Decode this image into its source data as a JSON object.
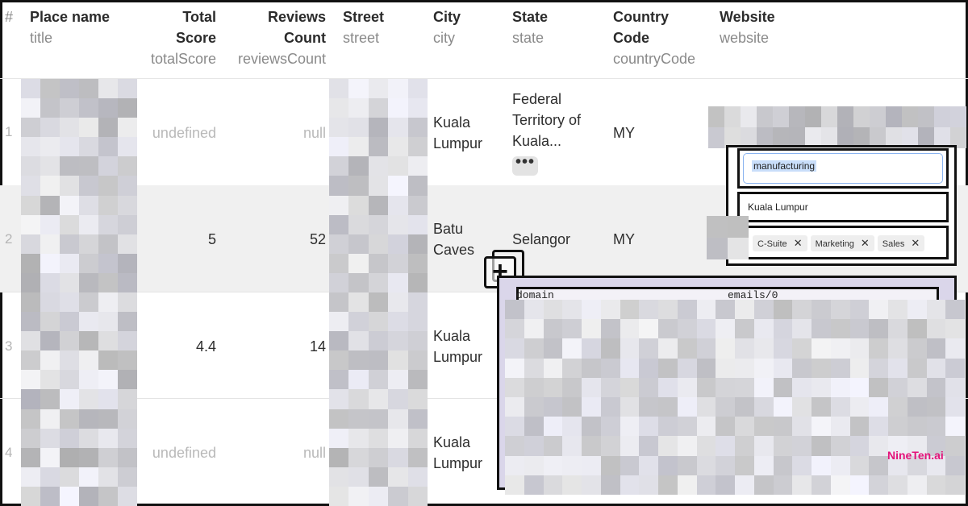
{
  "table": {
    "columns": [
      {
        "label": "#",
        "key": ""
      },
      {
        "label": "Place name",
        "key": "title"
      },
      {
        "label_lines": [
          "Total",
          "Score"
        ],
        "key": "totalScore"
      },
      {
        "label_lines": [
          "Reviews",
          "Count"
        ],
        "key": "reviewsCount"
      },
      {
        "label": "Street",
        "key": "street"
      },
      {
        "label": "City",
        "key": "city"
      },
      {
        "label": "State",
        "key": "state"
      },
      {
        "label_lines": [
          "Country",
          "Code"
        ],
        "key": "countryCode"
      },
      {
        "label": "Website",
        "key": "website"
      }
    ],
    "rows": [
      {
        "num": "1",
        "totalScore": "undefined",
        "reviewsCount": "null",
        "city_lines": [
          "Kuala",
          "Lumpur"
        ],
        "state_lines": [
          "Federal",
          "Territory of",
          "Kuala..."
        ],
        "state_more": "•••",
        "countryCode": "MY"
      },
      {
        "num": "2",
        "totalScore": "5",
        "reviewsCount": "52",
        "city_lines": [
          "Batu",
          "Caves"
        ],
        "state": "Selangor",
        "countryCode": "MY"
      },
      {
        "num": "3",
        "totalScore": "4.4",
        "reviewsCount": "14",
        "city_lines": [
          "Kuala",
          "Lumpur"
        ]
      },
      {
        "num": "4",
        "totalScore": "undefined",
        "reviewsCount": "null",
        "city_lines": [
          "Kuala",
          "Lumpur"
        ]
      }
    ]
  },
  "overlay": {
    "keyword_value": "manufacturing",
    "location_value": "Kuala Lumpur",
    "tags": [
      "C-Suite",
      "Marketing",
      "Sales"
    ],
    "tag_remove_glyph": "✕",
    "plus_glyph": "+",
    "output_columns": [
      "domain",
      "emails/0"
    ]
  },
  "brand": "NineTen.ai",
  "colors": {
    "brand": "#e4137a",
    "selection": "#c9defa",
    "overlay_bg": "#dad6ea"
  }
}
